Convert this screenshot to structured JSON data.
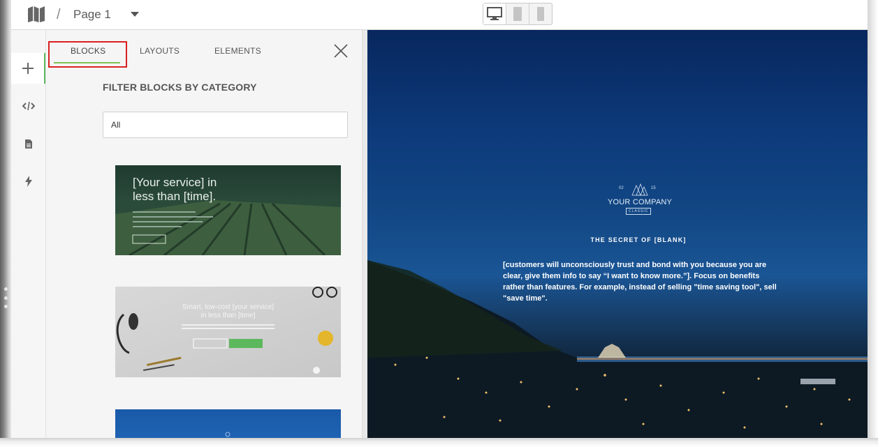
{
  "topbar": {
    "breadcrumb_separator": "/",
    "page_name": "Page 1",
    "devices": [
      "desktop",
      "tablet",
      "mobile"
    ],
    "active_device": "desktop"
  },
  "rail": {
    "items": [
      {
        "name": "add",
        "icon": "plus-icon",
        "active": true
      },
      {
        "name": "code",
        "icon": "code-icon"
      },
      {
        "name": "page",
        "icon": "document-icon"
      },
      {
        "name": "actions",
        "icon": "lightning-icon"
      }
    ]
  },
  "panel": {
    "tabs": [
      {
        "label": "BLOCKS",
        "active": true
      },
      {
        "label": "LAYOUTS"
      },
      {
        "label": "ELEMENTS"
      }
    ],
    "filter_title": "FILTER BLOCKS BY CATEGORY",
    "filter_value": "All",
    "thumbnails": [
      {
        "title_line1": "[Your service] in",
        "title_line2": "less than [time]."
      },
      {
        "title_line1": "Smart, low-cost [your service]",
        "title_line2": "in less than [time]"
      },
      {
        "title_line1": ""
      }
    ]
  },
  "preview": {
    "logo_left_num": "02",
    "logo_right_num": "15",
    "company_name": "YOUR COMPANY",
    "company_tag": "CLASSIC",
    "heading": "THE SECRET OF [BLANK]",
    "body": "[customers will unconsciously trust and bond with you because you are clear, give them info to say “I want to know more.”]. Focus on benefits rather than features. For example, instead of selling \"time saving tool\", sell \"save time\"."
  },
  "colors": {
    "accent_green": "#7cc152",
    "highlight_red": "#d9201f",
    "preview_sky": "#124784"
  }
}
